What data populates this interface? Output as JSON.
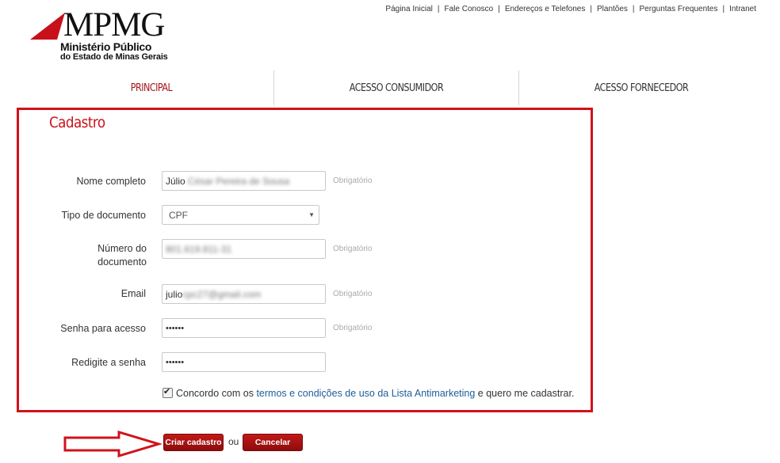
{
  "logo": {
    "acronym": "MPMG",
    "line1": "Ministério Público",
    "line2": "do Estado de Minas Gerais",
    "brand_color": "#c8101a"
  },
  "top_links": [
    "Página Inicial",
    "Fale Conosco",
    "Endereços e Telefones",
    "Plantões",
    "Perguntas Frequentes",
    "Intranet"
  ],
  "nav": {
    "tabs": [
      "PRINCIPAL",
      "ACESSO CONSUMIDOR",
      "ACESSO FORNECEDOR"
    ],
    "active": "PRINCIPAL"
  },
  "form": {
    "title": "Cadastro",
    "required_text": "Obrigatório",
    "fields": {
      "nome": {
        "label": "Nome completo",
        "value_visible": "Júlio",
        "value_blurred": "César Pereira de Sousa"
      },
      "tipo": {
        "label": "Tipo de documento",
        "value": "CPF"
      },
      "numero": {
        "label_line1": "Número do",
        "label_line2": "documento",
        "value_blurred": "801.619.811-31"
      },
      "email": {
        "label": "Email",
        "value_visible": "julio",
        "value_blurred": "cpc27@gmail.com"
      },
      "senha": {
        "label": "Senha para acesso",
        "value": "••••••"
      },
      "resenha": {
        "label": "Redigite a senha",
        "value": "••••••"
      }
    },
    "agree": {
      "checked": true,
      "prefix": "Concordo com os",
      "link": "termos e condições de uso da Lista Antimarketing",
      "suffix": "e quero me cadastrar."
    }
  },
  "actions": {
    "create": "Criar cadastro",
    "or": "ou",
    "cancel": "Cancelar"
  },
  "colors": {
    "highlight_border": "#d0121b",
    "button": "#a81212",
    "link": "#1f5c99"
  }
}
